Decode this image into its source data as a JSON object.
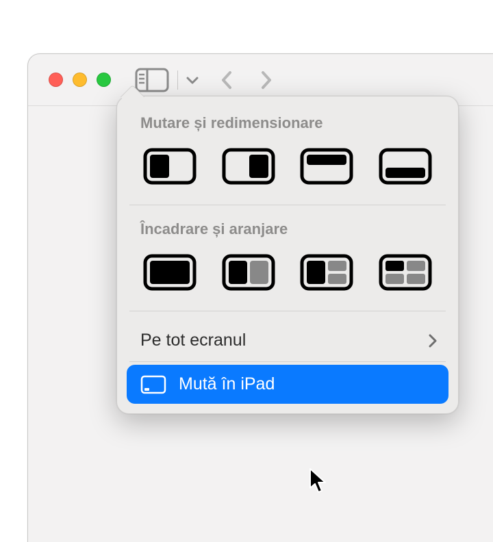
{
  "menu": {
    "section_move_resize": "Mutare și redimensionare",
    "section_fit_arrange": "Încadrare și aranjare",
    "fullscreen": "Pe tot ecranul",
    "move_to_ipad": "Mută în iPad"
  },
  "icons": {
    "half_left": "half-left",
    "half_right": "half-right",
    "half_top": "half-top",
    "half_bottom": "half-bottom",
    "fill": "fill",
    "two_cols": "two-columns",
    "two_one": "two-plus-one",
    "quarters": "quarters"
  }
}
